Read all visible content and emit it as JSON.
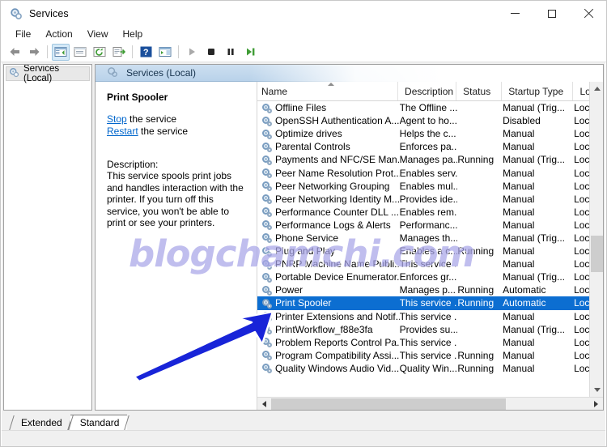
{
  "window": {
    "title": "Services",
    "icon": "services-gear-icon",
    "controls": {
      "minimize": "–",
      "maximize": "□",
      "close": "✕"
    }
  },
  "menubar": {
    "items": [
      "File",
      "Action",
      "View",
      "Help"
    ]
  },
  "toolbar": {
    "buttons": [
      {
        "name": "back-button",
        "icon": "left-arrow-icon"
      },
      {
        "name": "forward-button",
        "icon": "right-arrow-icon"
      },
      {
        "name": "show-hide-console-tree-button",
        "icon": "tree-pane-icon",
        "selected": true
      },
      {
        "name": "properties-button",
        "icon": "properties-icon"
      },
      {
        "name": "refresh-button",
        "icon": "refresh-icon"
      },
      {
        "name": "export-list-button",
        "icon": "export-list-icon"
      },
      {
        "name": "help-button",
        "icon": "help-question-icon"
      },
      {
        "name": "show-hide-action-pane-button",
        "icon": "action-pane-icon"
      },
      {
        "name": "start-service-button",
        "icon": "play-icon"
      },
      {
        "name": "stop-service-button",
        "icon": "stop-icon"
      },
      {
        "name": "pause-service-button",
        "icon": "pause-icon"
      },
      {
        "name": "restart-service-button",
        "icon": "restart-icon"
      }
    ]
  },
  "tree": {
    "node_label": "Services (Local)",
    "node_icon": "services-gear-icon"
  },
  "pane": {
    "header_label": "Services (Local)",
    "header_icon": "services-gear-icon"
  },
  "details": {
    "service_name": "Print Spooler",
    "stop_link": "Stop",
    "stop_suffix": " the service",
    "restart_link": "Restart",
    "restart_suffix": " the service",
    "description_label": "Description:",
    "description": "This service spools print jobs and handles interaction with the printer. If you turn off this service, you won't be able to print or see your printers."
  },
  "list": {
    "columns": [
      {
        "label": "Name",
        "sorted": "asc"
      },
      {
        "label": "Description"
      },
      {
        "label": "Status"
      },
      {
        "label": "Startup Type"
      },
      {
        "label": "Log"
      }
    ],
    "rows": [
      {
        "name": "Offline Files",
        "description": "The Offline ...",
        "status": "",
        "startup": "Manual (Trig...",
        "logon": "Locà",
        "selected": false
      },
      {
        "name": "OpenSSH Authentication A...",
        "description": "Agent to ho...",
        "status": "",
        "startup": "Disabled",
        "logon": "Locà",
        "selected": false
      },
      {
        "name": "Optimize drives",
        "description": "Helps the c...",
        "status": "",
        "startup": "Manual",
        "logon": "Locà",
        "selected": false
      },
      {
        "name": "Parental Controls",
        "description": "Enforces pa...",
        "status": "",
        "startup": "Manual",
        "logon": "Locà",
        "selected": false
      },
      {
        "name": "Payments and NFC/SE Man...",
        "description": "Manages pa...",
        "status": "Running",
        "startup": "Manual (Trig...",
        "logon": "Locà",
        "selected": false
      },
      {
        "name": "Peer Name Resolution Prot...",
        "description": "Enables serv...",
        "status": "",
        "startup": "Manual",
        "logon": "Locà",
        "selected": false
      },
      {
        "name": "Peer Networking Grouping",
        "description": "Enables mul...",
        "status": "",
        "startup": "Manual",
        "logon": "Locà",
        "selected": false
      },
      {
        "name": "Peer Networking Identity M...",
        "description": "Provides ide...",
        "status": "",
        "startup": "Manual",
        "logon": "Locà",
        "selected": false
      },
      {
        "name": "Performance Counter DLL ...",
        "description": "Enables rem...",
        "status": "",
        "startup": "Manual",
        "logon": "Locà",
        "selected": false
      },
      {
        "name": "Performance Logs & Alerts",
        "description": "Performanc...",
        "status": "",
        "startup": "Manual",
        "logon": "Locà",
        "selected": false
      },
      {
        "name": "Phone Service",
        "description": "Manages th...",
        "status": "",
        "startup": "Manual (Trig...",
        "logon": "Locà",
        "selected": false
      },
      {
        "name": "Plug and Play",
        "description": "Enables a c...",
        "status": "Running",
        "startup": "Manual",
        "logon": "Locà",
        "selected": false
      },
      {
        "name": "PNRP Machine Name Publi...",
        "description": "This service ...",
        "status": "",
        "startup": "Manual",
        "logon": "Locà",
        "selected": false
      },
      {
        "name": "Portable Device Enumerator...",
        "description": "Enforces gr...",
        "status": "",
        "startup": "Manual (Trig...",
        "logon": "Locà",
        "selected": false
      },
      {
        "name": "Power",
        "description": "Manages p...",
        "status": "Running",
        "startup": "Automatic",
        "logon": "Locà",
        "selected": false
      },
      {
        "name": "Print Spooler",
        "description": "This service ...",
        "status": "Running",
        "startup": "Automatic",
        "logon": "Locà",
        "selected": true
      },
      {
        "name": "Printer Extensions and Notif...",
        "description": "This service ...",
        "status": "",
        "startup": "Manual",
        "logon": "Locà",
        "selected": false
      },
      {
        "name": "PrintWorkflow_f88e3fa",
        "description": "Provides su...",
        "status": "",
        "startup": "Manual (Trig...",
        "logon": "Locà",
        "selected": false
      },
      {
        "name": "Problem Reports Control Pa...",
        "description": "This service ...",
        "status": "",
        "startup": "Manual",
        "logon": "Locà",
        "selected": false
      },
      {
        "name": "Program Compatibility Assi...",
        "description": "This service ...",
        "status": "Running",
        "startup": "Manual",
        "logon": "Locà",
        "selected": false
      },
      {
        "name": "Quality Windows Audio Vid...",
        "description": "Quality Win...",
        "status": "Running",
        "startup": "Manual",
        "logon": "Locà",
        "selected": false
      }
    ]
  },
  "tabs": {
    "items": [
      {
        "label": "Extended",
        "active": false
      },
      {
        "label": "Standard",
        "active": true
      }
    ]
  },
  "watermark": {
    "text": "blogchamchi.com",
    "color": "#a9a6e8"
  },
  "annotation": {
    "type": "arrow",
    "color": "#1824d8",
    "points_to": "Print Spooler"
  }
}
